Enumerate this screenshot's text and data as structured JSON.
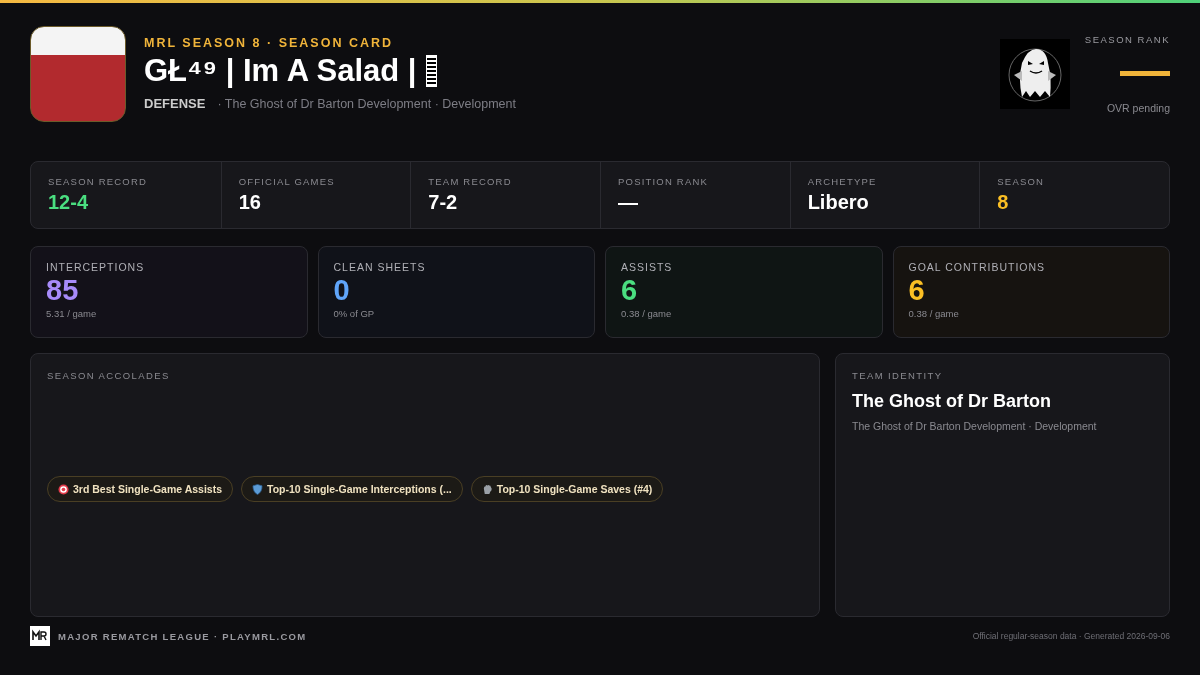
{
  "header": {
    "eyebrow": "MRL SEASON 8 · SEASON CARD",
    "name": "GŁ⁴⁹ | Im A Salad |",
    "position": "DEFENSE",
    "team_line": "· The Ghost of Dr Barton Development · Development",
    "rank_label": "SEASON RANK",
    "rank_note": "OVR pending"
  },
  "summary": [
    {
      "label": "SEASON RECORD",
      "value": "12-4",
      "color": "#4ade80"
    },
    {
      "label": "OFFICIAL GAMES",
      "value": "16",
      "color": "#ffffff"
    },
    {
      "label": "TEAM RECORD",
      "value": "7-2",
      "color": "#ffffff"
    },
    {
      "label": "POSITION RANK",
      "value": "—",
      "color": "#ffffff"
    },
    {
      "label": "ARCHETYPE",
      "value": "Libero",
      "color": "#ffffff"
    },
    {
      "label": "SEASON",
      "value": "8",
      "color": "#fbbf24"
    }
  ],
  "stats": [
    {
      "label": "INTERCEPTIONS",
      "value": "85",
      "sub": "5.31 / game",
      "color": "#a78bfa"
    },
    {
      "label": "CLEAN SHEETS",
      "value": "0",
      "sub": "0% of GP",
      "color": "#60a5fa"
    },
    {
      "label": "ASSISTS",
      "value": "6",
      "sub": "0.38 / game",
      "color": "#4ade80"
    },
    {
      "label": "GOAL CONTRIBUTIONS",
      "value": "6",
      "sub": "0.38 / game",
      "color": "#fbbf24"
    }
  ],
  "accolades": {
    "title": "SEASON ACCOLADES",
    "items": [
      {
        "kind": "target",
        "label": "3rd Best Single-Game Assists"
      },
      {
        "kind": "shield",
        "label": "Top-10 Single-Game Interceptions (..."
      },
      {
        "kind": "glove",
        "label": "Top-10 Single-Game Saves (#4)"
      }
    ]
  },
  "team_identity": {
    "title": "TEAM IDENTITY",
    "name": "The Ghost of Dr Barton",
    "sub": "The Ghost of Dr Barton Development · Development"
  },
  "footer": {
    "brand": "MAJOR REMATCH LEAGUE · PLAYMRL.COM",
    "note": "Official regular-season data · Generated 2026-09-06"
  }
}
